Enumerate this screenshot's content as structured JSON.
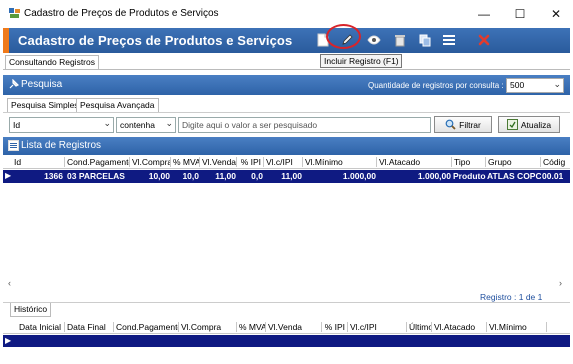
{
  "window": {
    "title": "Cadastro de Preços de Produtos e Serviços",
    "controls": {
      "minimize": "—",
      "maximize": "☐",
      "close": "✕"
    }
  },
  "header": {
    "title": "Cadastro de Preços de Produtos e Serviços",
    "toolbar": [
      "new-document-icon",
      "pencil-icon",
      "view-eye-icon",
      "delete-bin-icon",
      "copy-icon",
      "menu-icon",
      "cancel-x-icon"
    ],
    "tooltip": "Incluir Registro (F1)"
  },
  "tabs": {
    "consultando": "Consultando Registros"
  },
  "pesquisa": {
    "label": "Pesquisa",
    "qty_label": "Quantidade de registros por consulta :",
    "qty_value": "500",
    "subtabs": [
      "Pesquisa Simples",
      "Pesquisa Avançada"
    ],
    "field_value": "Id",
    "operator_value": "contenha",
    "search_placeholder": "Digite aqui o valor a ser pesquisado",
    "filter_label": "Filtrar",
    "refresh_label": "Atualiza"
  },
  "lista": {
    "label": "Lista de Registros",
    "columns": [
      "Id",
      "Cond.Pagamento",
      "Vl.Compra",
      "% MVA",
      "Vl.Venda",
      "% IPI",
      "Vl.c/IPI",
      "Vl.Mínimo",
      "Vl.Atacado",
      "Tipo",
      "Grupo",
      "Códig"
    ],
    "rows": [
      [
        "1366",
        "03 PARCELAS",
        "10,00",
        "10,0",
        "11,00",
        "0,0",
        "11,00",
        "1.000,00",
        "1.000,00",
        "Produto",
        "ATLAS COPCO",
        "00.01"
      ]
    ],
    "count": "Registro : 1 de 1"
  },
  "historico": {
    "tab": "Histórico",
    "columns": [
      "Data Inicial",
      "Data Final",
      "Cond.Pagamento",
      "Vl.Compra",
      "% MVA",
      "Vl.Venda",
      "% IPI",
      "Vl.c/IPI",
      "Último",
      "Vl.Atacado",
      "Vl.Mínimo"
    ]
  },
  "colors": {
    "header_blue": "#2a5b9c",
    "accent_orange": "#f07a1a",
    "selected_row": "#0f1a82",
    "highlight_red": "#d8242a"
  }
}
